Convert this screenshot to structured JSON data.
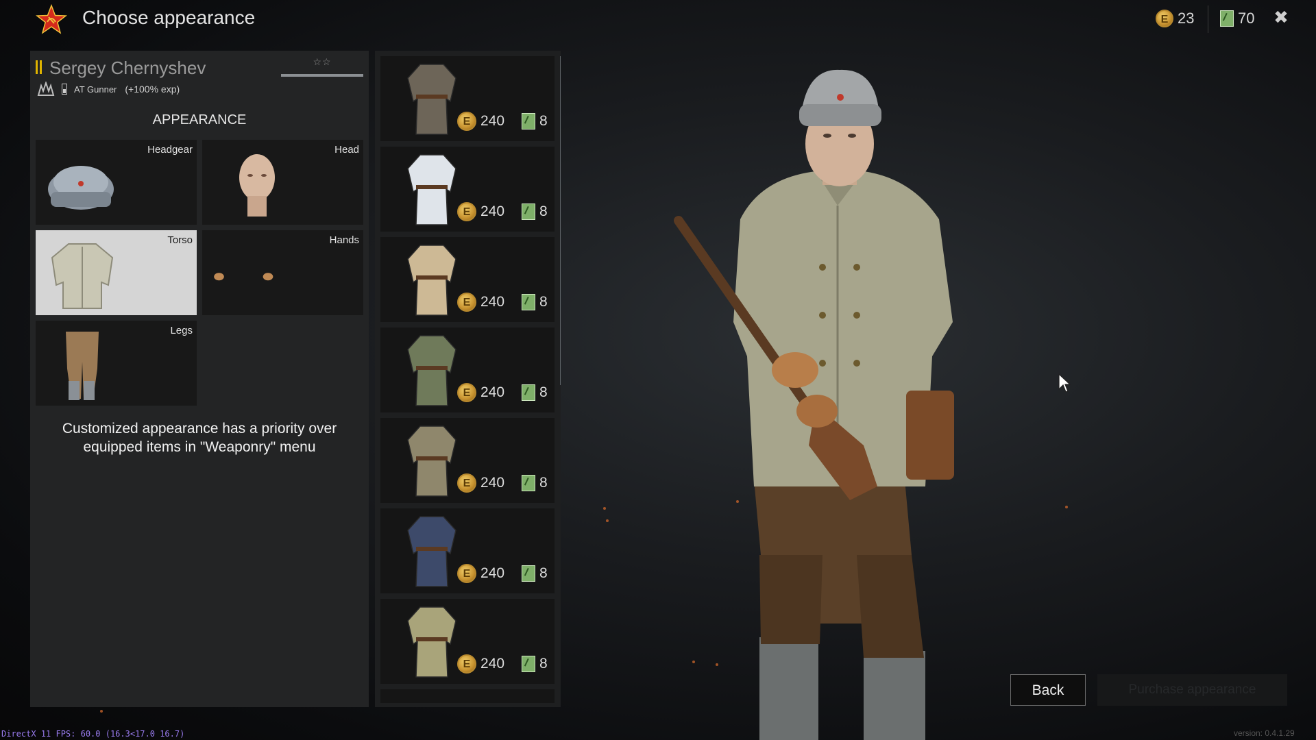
{
  "header": {
    "title": "Choose appearance",
    "silver": "23",
    "blueprints": "70"
  },
  "soldier": {
    "name": "Sergey Chernyshev",
    "class": "AT Gunner",
    "exp_bonus": "(+100% exp)",
    "stars": "☆☆"
  },
  "appearance": {
    "heading": "APPEARANCE",
    "slots": [
      {
        "label": "Headgear",
        "selected": false
      },
      {
        "label": "Head",
        "selected": false
      },
      {
        "label": "Torso",
        "selected": true
      },
      {
        "label": "Hands",
        "selected": false
      },
      {
        "label": "Legs",
        "selected": false
      }
    ],
    "notice": "Customized appearance has a priority over equipped items in \"Weaponry\" menu"
  },
  "items": [
    {
      "price": "240",
      "bp": "8",
      "color": "#6d6558"
    },
    {
      "price": "240",
      "bp": "8",
      "color": "#dfe4ea"
    },
    {
      "price": "240",
      "bp": "8",
      "color": "#cdb995"
    },
    {
      "price": "240",
      "bp": "8",
      "color": "#6f7a5a"
    },
    {
      "price": "240",
      "bp": "8",
      "color": "#8f876c"
    },
    {
      "price": "240",
      "bp": "8",
      "color": "#3d4a6a"
    },
    {
      "price": "240",
      "bp": "8",
      "color": "#a9a47a"
    }
  ],
  "buttons": {
    "back": "Back",
    "purchase": "Purchase appearance"
  },
  "footer": {
    "fps": "DirectX 11 FPS: 60.0 (16.3<17.0 16.7)",
    "version": "version: 0.4.1.29"
  },
  "colors": {
    "accent_gold": "#e0b400",
    "coin_gold": "#c89330",
    "selected_slot": "#d5d5d5"
  }
}
